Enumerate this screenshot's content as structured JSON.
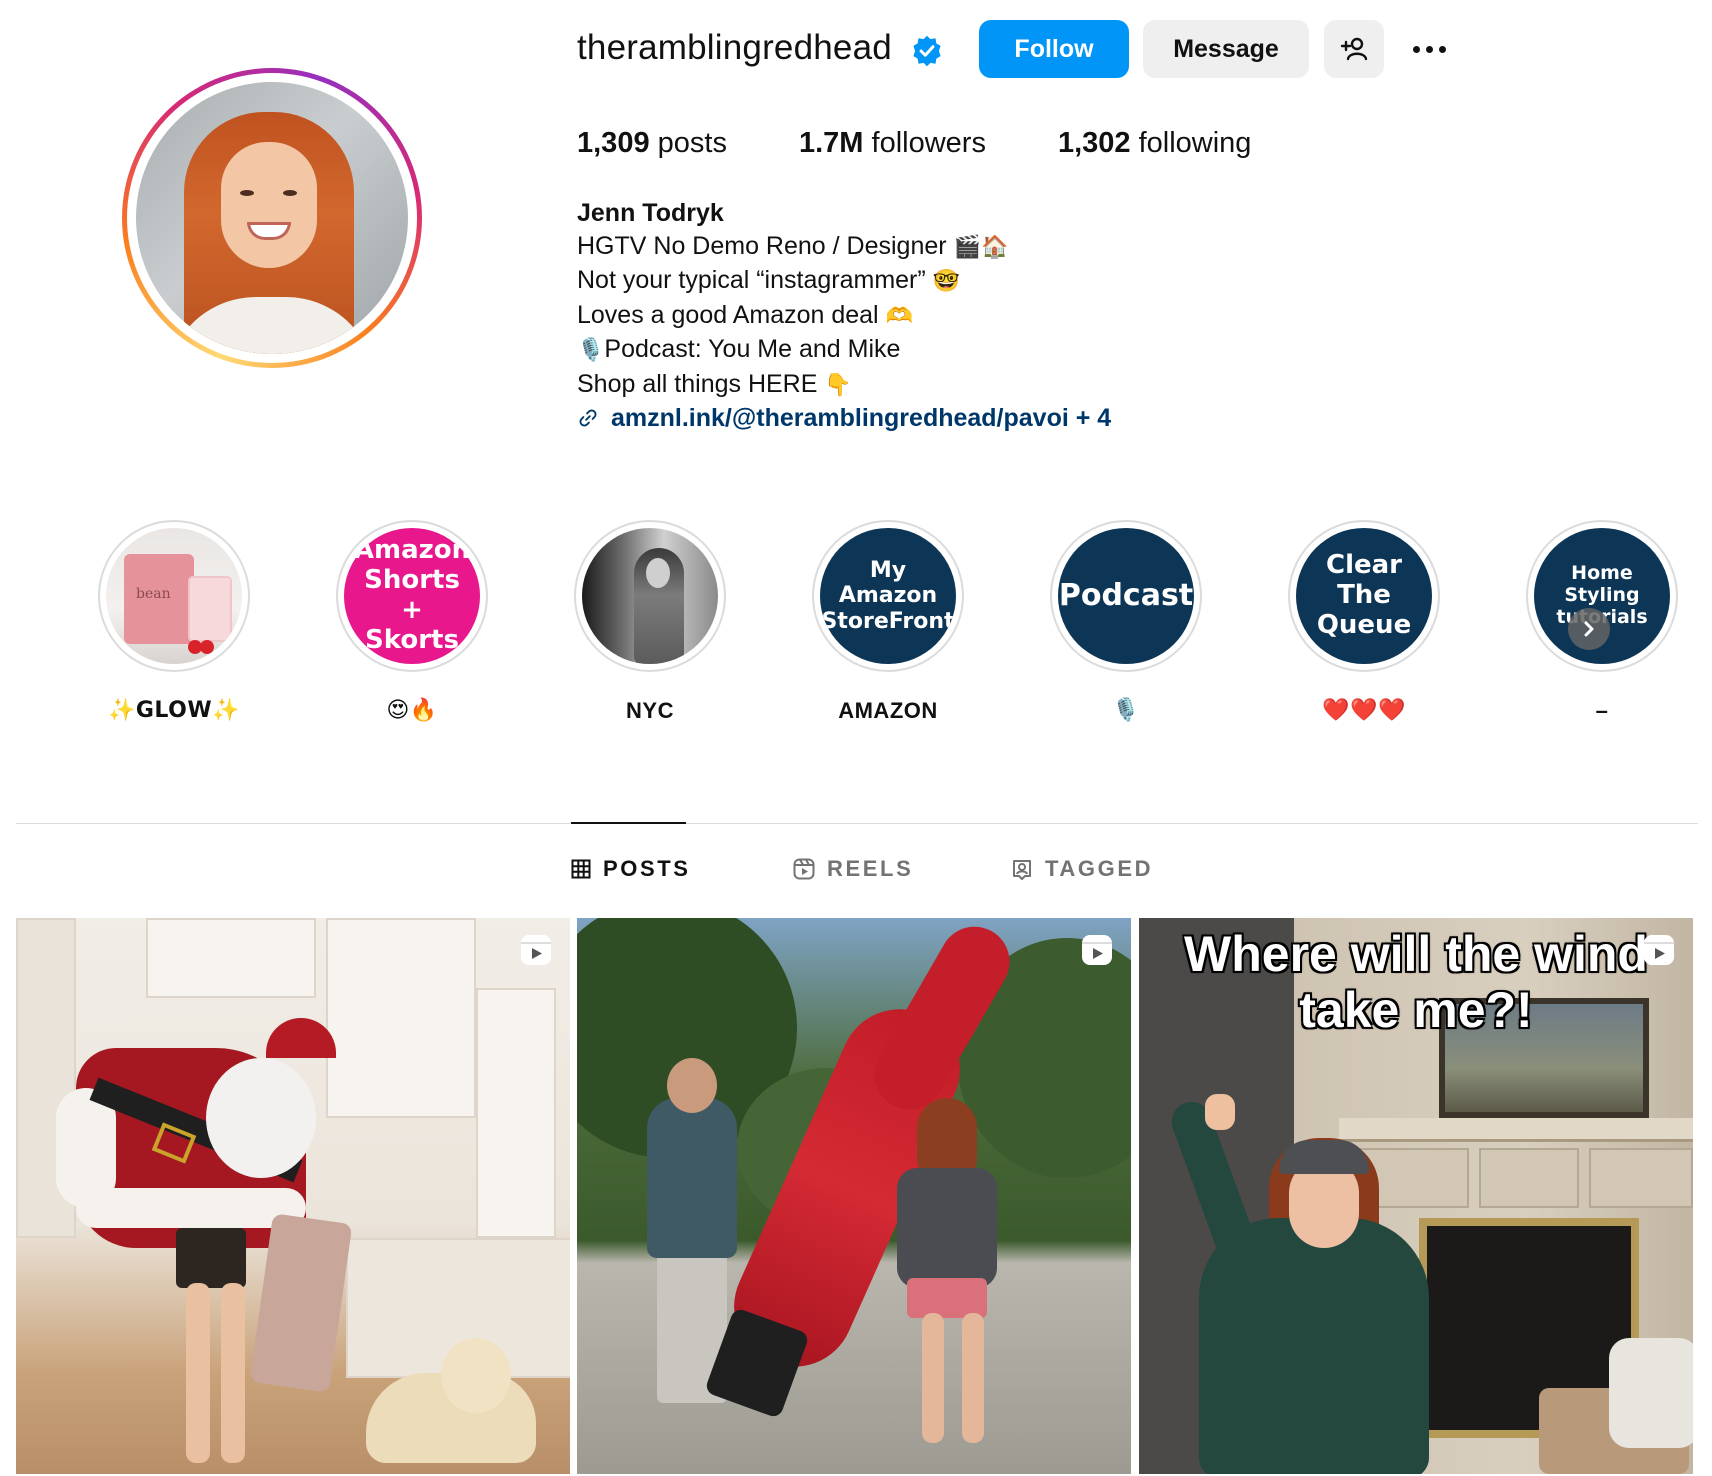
{
  "profile": {
    "username": "theramblingredhead",
    "verified_icon": "verified-badge-icon",
    "follow_label": "Follow",
    "message_label": "Message",
    "add_user_icon": "add-user-icon",
    "more_icon": "more-options-icon"
  },
  "stats": {
    "posts_count": "1,309",
    "posts_label": "posts",
    "followers_count": "1.7M",
    "followers_label": "followers",
    "following_count": "1,302",
    "following_label": "following"
  },
  "bio": {
    "full_name": "Jenn Todryk",
    "line1": "HGTV No Demo Reno / Designer",
    "line1_emoji": "🎬🏠",
    "line2": "Not your typical “instagrammer”",
    "line2_emoji": "🤓",
    "line3": "Loves a good Amazon deal",
    "line3_emoji": "🫶",
    "line4_emoji": "🎙️",
    "line4": "Podcast: You Me and Mike",
    "line5": "Shop all things HERE",
    "line5_emoji": "👇",
    "link_text": "amznl.ink/@theramblingredhead/pavoi + 4",
    "link_icon": "link-icon"
  },
  "highlights": [
    {
      "label": "✨GLOW✨",
      "cover_text": "bean"
    },
    {
      "label": "😍🔥",
      "cover_text": "Amazon Shorts + Skorts"
    },
    {
      "label": "NYC",
      "cover_text": ""
    },
    {
      "label": "AMAZON",
      "cover_text": "My Amazon StoreFront"
    },
    {
      "label": "🎙️",
      "cover_text": "Podcast"
    },
    {
      "label": "❤️❤️❤️",
      "cover_text": "Clear The Queue"
    },
    {
      "label": "–",
      "cover_text": "Home Styling tutorials"
    }
  ],
  "tabs": [
    {
      "label": "POSTS",
      "icon": "grid-icon",
      "active": true
    },
    {
      "label": "REELS",
      "icon": "reels-icon",
      "active": false
    },
    {
      "label": "TAGGED",
      "icon": "tagged-icon",
      "active": false
    }
  ],
  "posts": [
    {
      "type": "reel",
      "overlay_text": ""
    },
    {
      "type": "reel",
      "overlay_text": ""
    },
    {
      "type": "reel",
      "overlay_text": "Where will the wind take me?!"
    }
  ],
  "colors": {
    "follow_button": "#0095f6",
    "link": "#00376b",
    "highlight_navy": "#0d3556",
    "highlight_pink": "#e8178c"
  }
}
